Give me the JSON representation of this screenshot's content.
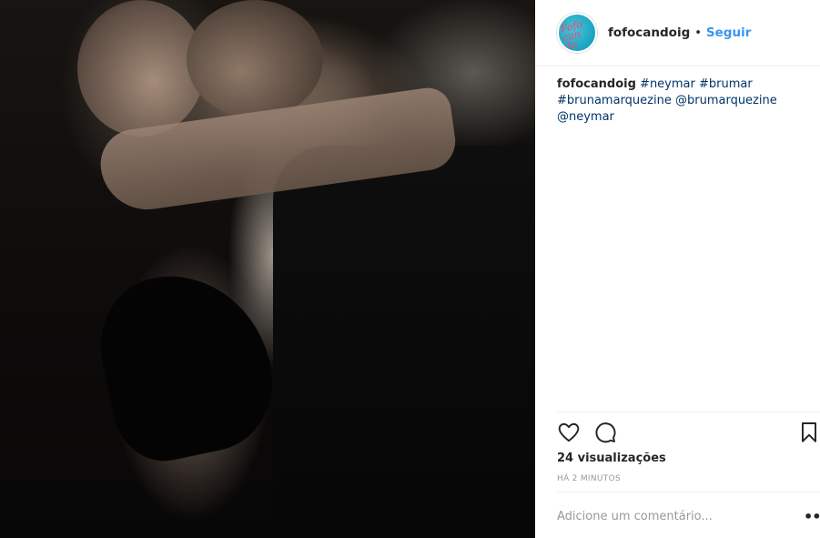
{
  "post": {
    "media": {
      "alt": ""
    },
    "header": {
      "avatar_text": "Fofo can do",
      "username": "fofocandoig",
      "separator": "•",
      "follow_label": "Seguir"
    },
    "caption": {
      "username": "fofocandoig",
      "tags": [
        "#neymar",
        "#brumar",
        "#brunamarquezine",
        "@brumarquezine",
        "@neymar"
      ]
    },
    "actions": {
      "like_icon": "heart-icon",
      "comment_icon": "speech-bubble-icon",
      "save_icon": "bookmark-icon"
    },
    "stats": {
      "views": "24 visualizações",
      "time": "HÁ 2 MINUTOS"
    },
    "comment": {
      "placeholder": "Adicione um comentário...",
      "more_label": "•••"
    },
    "colors": {
      "accent": "#3897f0",
      "tag": "#003569",
      "muted": "#999999",
      "text": "#262626",
      "divider": "#efefef"
    }
  }
}
